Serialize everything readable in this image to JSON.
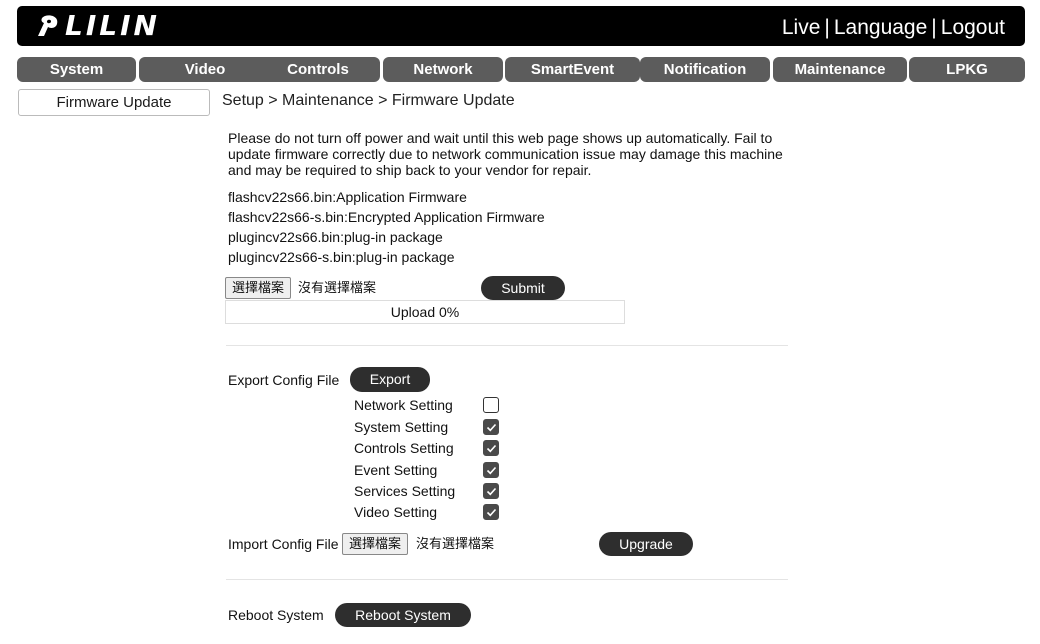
{
  "header": {
    "logo_text": "LILIN",
    "links": [
      "Live",
      "Language",
      "Logout"
    ],
    "separator": "|"
  },
  "nav": {
    "tabs": [
      "System",
      "Video",
      "Controls",
      "Network",
      "SmartEvent",
      "Notification",
      "Maintenance",
      "LPKG"
    ]
  },
  "sidebar": {
    "items": [
      "Firmware Update"
    ]
  },
  "breadcrumb": "Setup > Maintenance > Firmware Update",
  "firmware": {
    "warning": "Please do not turn off power and wait until this web page shows up automatically. Fail to update firmware correctly due to network communication issue may damage this machine and may be required to ship back to your vendor for repair.",
    "files": [
      "flashcv22s66.bin:Application Firmware",
      "flashcv22s66-s.bin:Encrypted Application Firmware",
      "plugincv22s66.bin:plug-in package",
      "plugincv22s66-s.bin:plug-in package"
    ],
    "choose_label": "選擇檔案",
    "no_file_label": "沒有選擇檔案",
    "submit_label": "Submit",
    "upload_text": "Upload 0%",
    "upload_progress": 0
  },
  "export": {
    "label": "Export Config File",
    "button": "Export",
    "options": [
      {
        "label": "Network Setting",
        "checked": false
      },
      {
        "label": "System Setting",
        "checked": true
      },
      {
        "label": "Controls Setting",
        "checked": true
      },
      {
        "label": "Event Setting",
        "checked": true
      },
      {
        "label": "Services Setting",
        "checked": true
      },
      {
        "label": "Video Setting",
        "checked": true
      }
    ]
  },
  "import": {
    "label": "Import Config File",
    "choose_label": "選擇檔案",
    "no_file_label": "沒有選擇檔案",
    "button": "Upgrade"
  },
  "reboot": {
    "label": "Reboot System",
    "button": "Reboot System"
  }
}
